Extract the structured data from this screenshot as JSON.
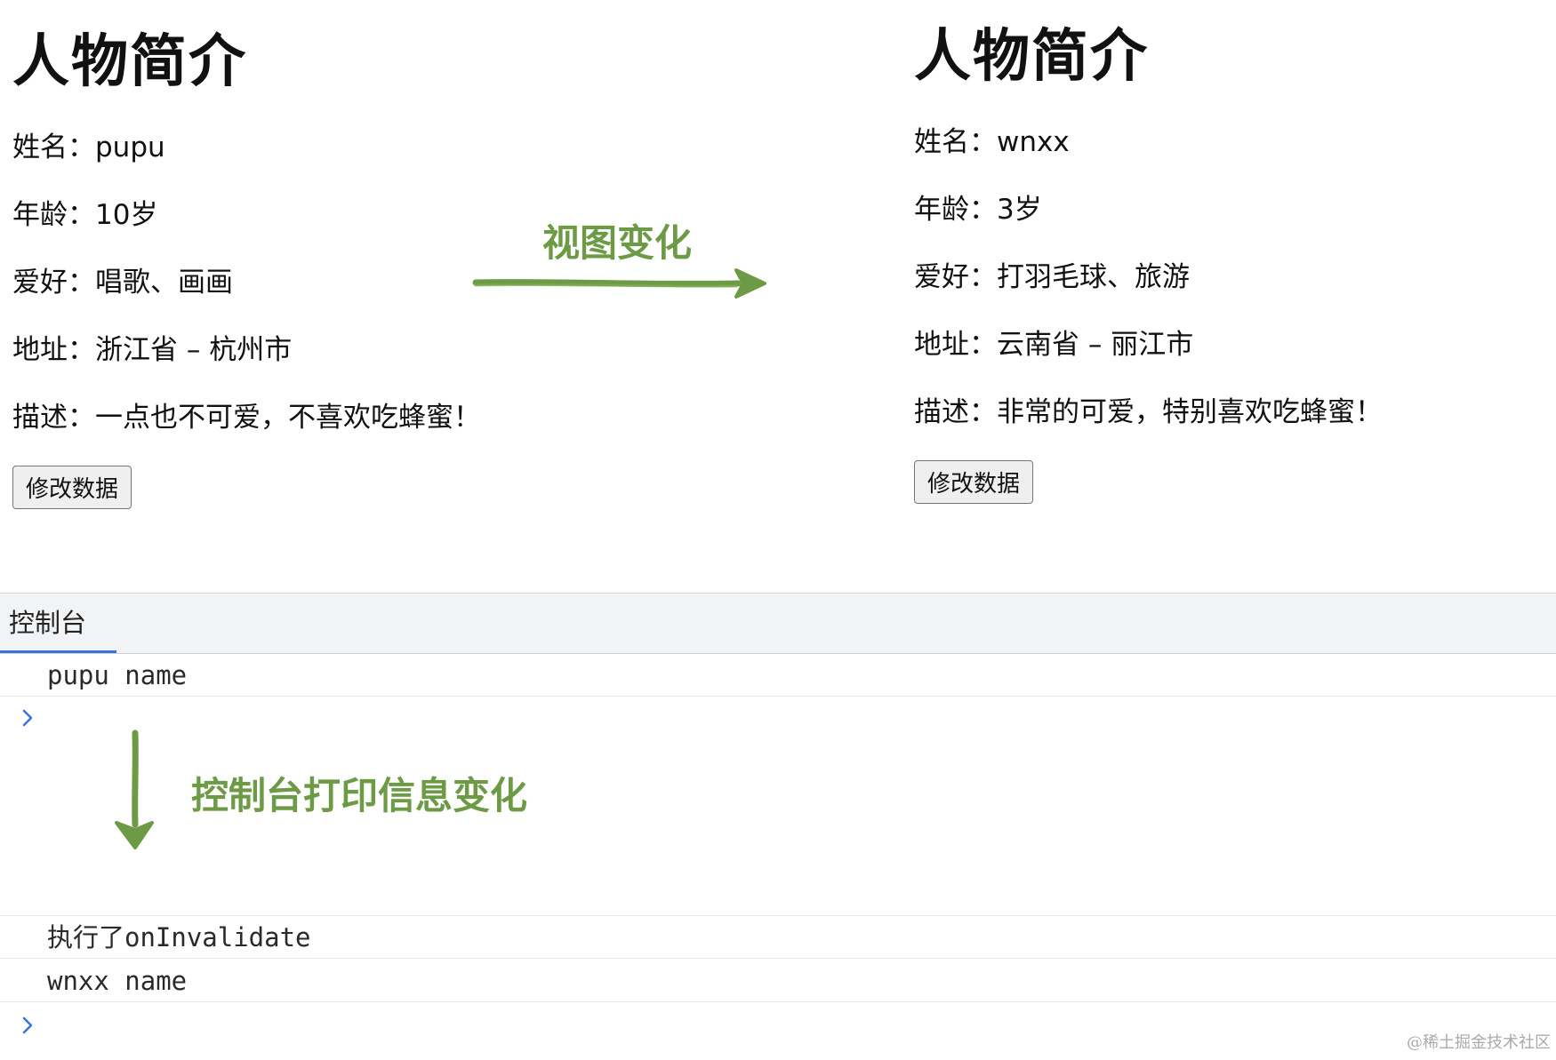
{
  "before": {
    "title": "人物简介",
    "name_line": "姓名：pupu",
    "age_line": "年龄：10岁",
    "hobby_line": "爱好：唱歌、画画",
    "address_line": "地址：浙江省 – 杭州市",
    "desc_line": "描述：一点也不可爱，不喜欢吃蜂蜜！",
    "button_label": "修改数据"
  },
  "after": {
    "title": "人物简介",
    "name_line": "姓名：wnxx",
    "age_line": "年龄：3岁",
    "hobby_line": "爱好：打羽毛球、旅游",
    "address_line": "地址：云南省 – 丽江市",
    "desc_line": "描述：非常的可爱，特别喜欢吃蜂蜜！",
    "button_label": "修改数据"
  },
  "annotations": {
    "view_change": "视图变化",
    "console_change": "控制台打印信息变化",
    "color": "#6d9a45"
  },
  "console": {
    "tab_label": "控制台",
    "logs": [
      "pupu name",
      "执行了onInvalidate",
      "wnxx name"
    ],
    "prompt_icon": "chevron-right-icon",
    "accent": "#3b74d8"
  },
  "watermark": "@稀土掘金技术社区"
}
